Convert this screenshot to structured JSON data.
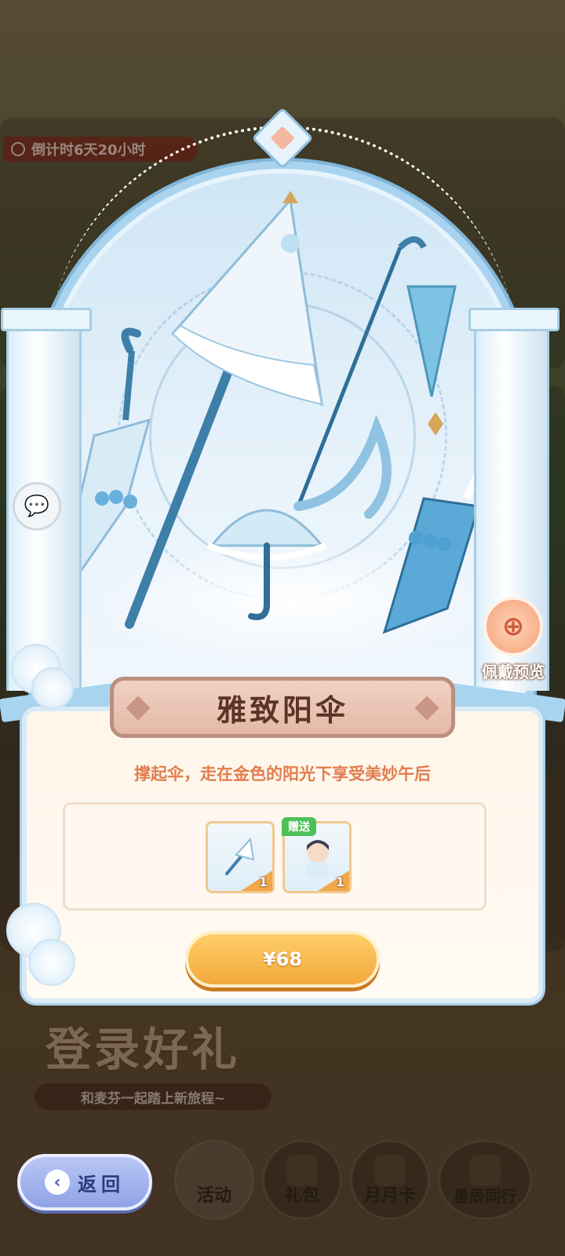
{
  "background": {
    "timer_text": "倒计时6天20小时",
    "login_title": "登录好礼",
    "login_subtitle": "和麦芬一起踏上新旅程~"
  },
  "modal": {
    "title": "雅致阳伞",
    "description": "撑起伞，走在金色的阳光下享受美妙午后",
    "preview_label": "佩戴预览",
    "rewards": [
      {
        "name": "umbrella-item",
        "count": "1",
        "tag": ""
      },
      {
        "name": "character-item",
        "count": "1",
        "tag": "赠送"
      }
    ],
    "price_label": "¥68"
  },
  "bottom_nav": {
    "back_label": "返回",
    "tabs": [
      {
        "label": "活动"
      },
      {
        "label": "礼包"
      },
      {
        "label": "月月卡"
      },
      {
        "label": "星辰同行"
      }
    ]
  },
  "colors": {
    "accent_orange": "#f2a83a",
    "desc_orange": "#e27d4d",
    "frame_blue": "#a9d3ee",
    "banner_brown": "#5a3526",
    "gift_tag_green": "#4fbf5a"
  },
  "icons": [
    "clock-icon",
    "chat-icon",
    "zoom-icon",
    "back-arrow-icon"
  ]
}
